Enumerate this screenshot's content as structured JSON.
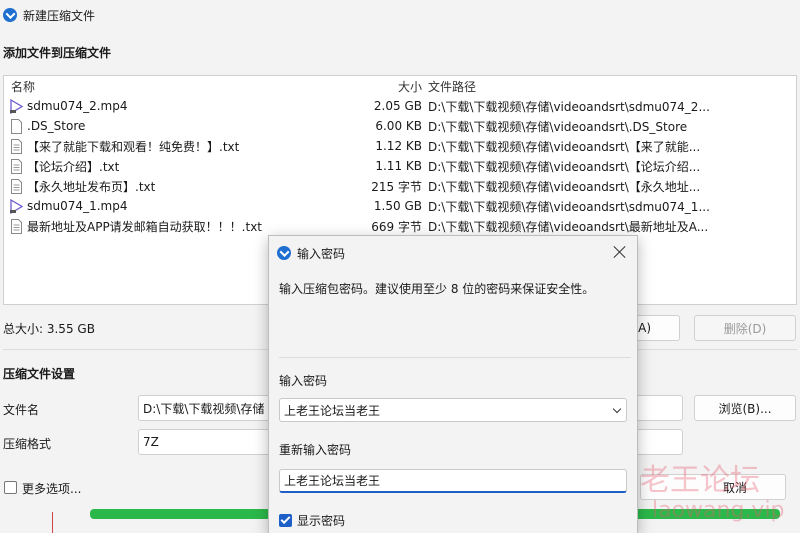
{
  "window": {
    "title": "新建压缩文件"
  },
  "add_section": {
    "heading": "添加文件到压缩文件"
  },
  "file_list": {
    "columns": {
      "name": "名称",
      "size": "大小",
      "path": "文件路径"
    },
    "rows": [
      {
        "icon": "video-file-icon",
        "name": "sdmu074_2.mp4",
        "size": "2.05 GB",
        "path": "D:\\下载\\下载视频\\存储\\videoandsrt\\sdmu074_2..."
      },
      {
        "icon": "file-icon",
        "name": ".DS_Store",
        "size": "6.00 KB",
        "path": "D:\\下载\\下载视频\\存储\\videoandsrt\\.DS_Store"
      },
      {
        "icon": "text-file-icon",
        "name": "【来了就能下载和观看！纯免费！】.txt",
        "size": "1.12 KB",
        "path": "D:\\下载\\下载视频\\存储\\videoandsrt\\【来了就能..."
      },
      {
        "icon": "text-file-icon",
        "name": "【论坛介绍】.txt",
        "size": "1.11 KB",
        "path": "D:\\下载\\下载视频\\存储\\videoandsrt\\【论坛介绍..."
      },
      {
        "icon": "text-file-icon",
        "name": "【永久地址发布页】.txt",
        "size": "215 字节",
        "path": "D:\\下载\\下载视频\\存储\\videoandsrt\\【永久地址..."
      },
      {
        "icon": "video-file-icon",
        "name": "sdmu074_1.mp4",
        "size": "1.50 GB",
        "path": "D:\\下载\\下载视频\\存储\\videoandsrt\\sdmu074_1..."
      },
      {
        "icon": "text-file-icon",
        "name": "最新地址及APP请发邮箱自动获取！！！.txt",
        "size": "669 字节",
        "path": "D:\\下载\\下载视频\\存储\\videoandsrt\\最新地址及A..."
      }
    ]
  },
  "total_size": "总大小: 3.55 GB",
  "buttons": {
    "add_partial": "A)",
    "delete": "删除(D)",
    "browse": "浏览(B)...",
    "cancel": "取消"
  },
  "settings": {
    "heading": "压缩文件设置",
    "filename_label": "文件名",
    "filename_value": "D:\\下载\\下载视频\\存储",
    "format_label": "压缩格式",
    "format_value": "7Z",
    "more_options_label": "更多选项..."
  },
  "password_dialog": {
    "title": "输入密码",
    "description": "输入压缩包密码。建议使用至少 8 位的密码来保证安全性。",
    "password_label": "输入密码",
    "password_value": "上老王论坛当老王",
    "confirm_label": "重新输入密码",
    "confirm_value": "上老王论坛当老王",
    "show_password_label": "显示密码",
    "show_password_checked": true
  },
  "watermark": {
    "text": "老王论坛",
    "url": "laowang.vip"
  },
  "colors": {
    "accent": "#1e5fc7",
    "progress": "#2bb84a"
  }
}
